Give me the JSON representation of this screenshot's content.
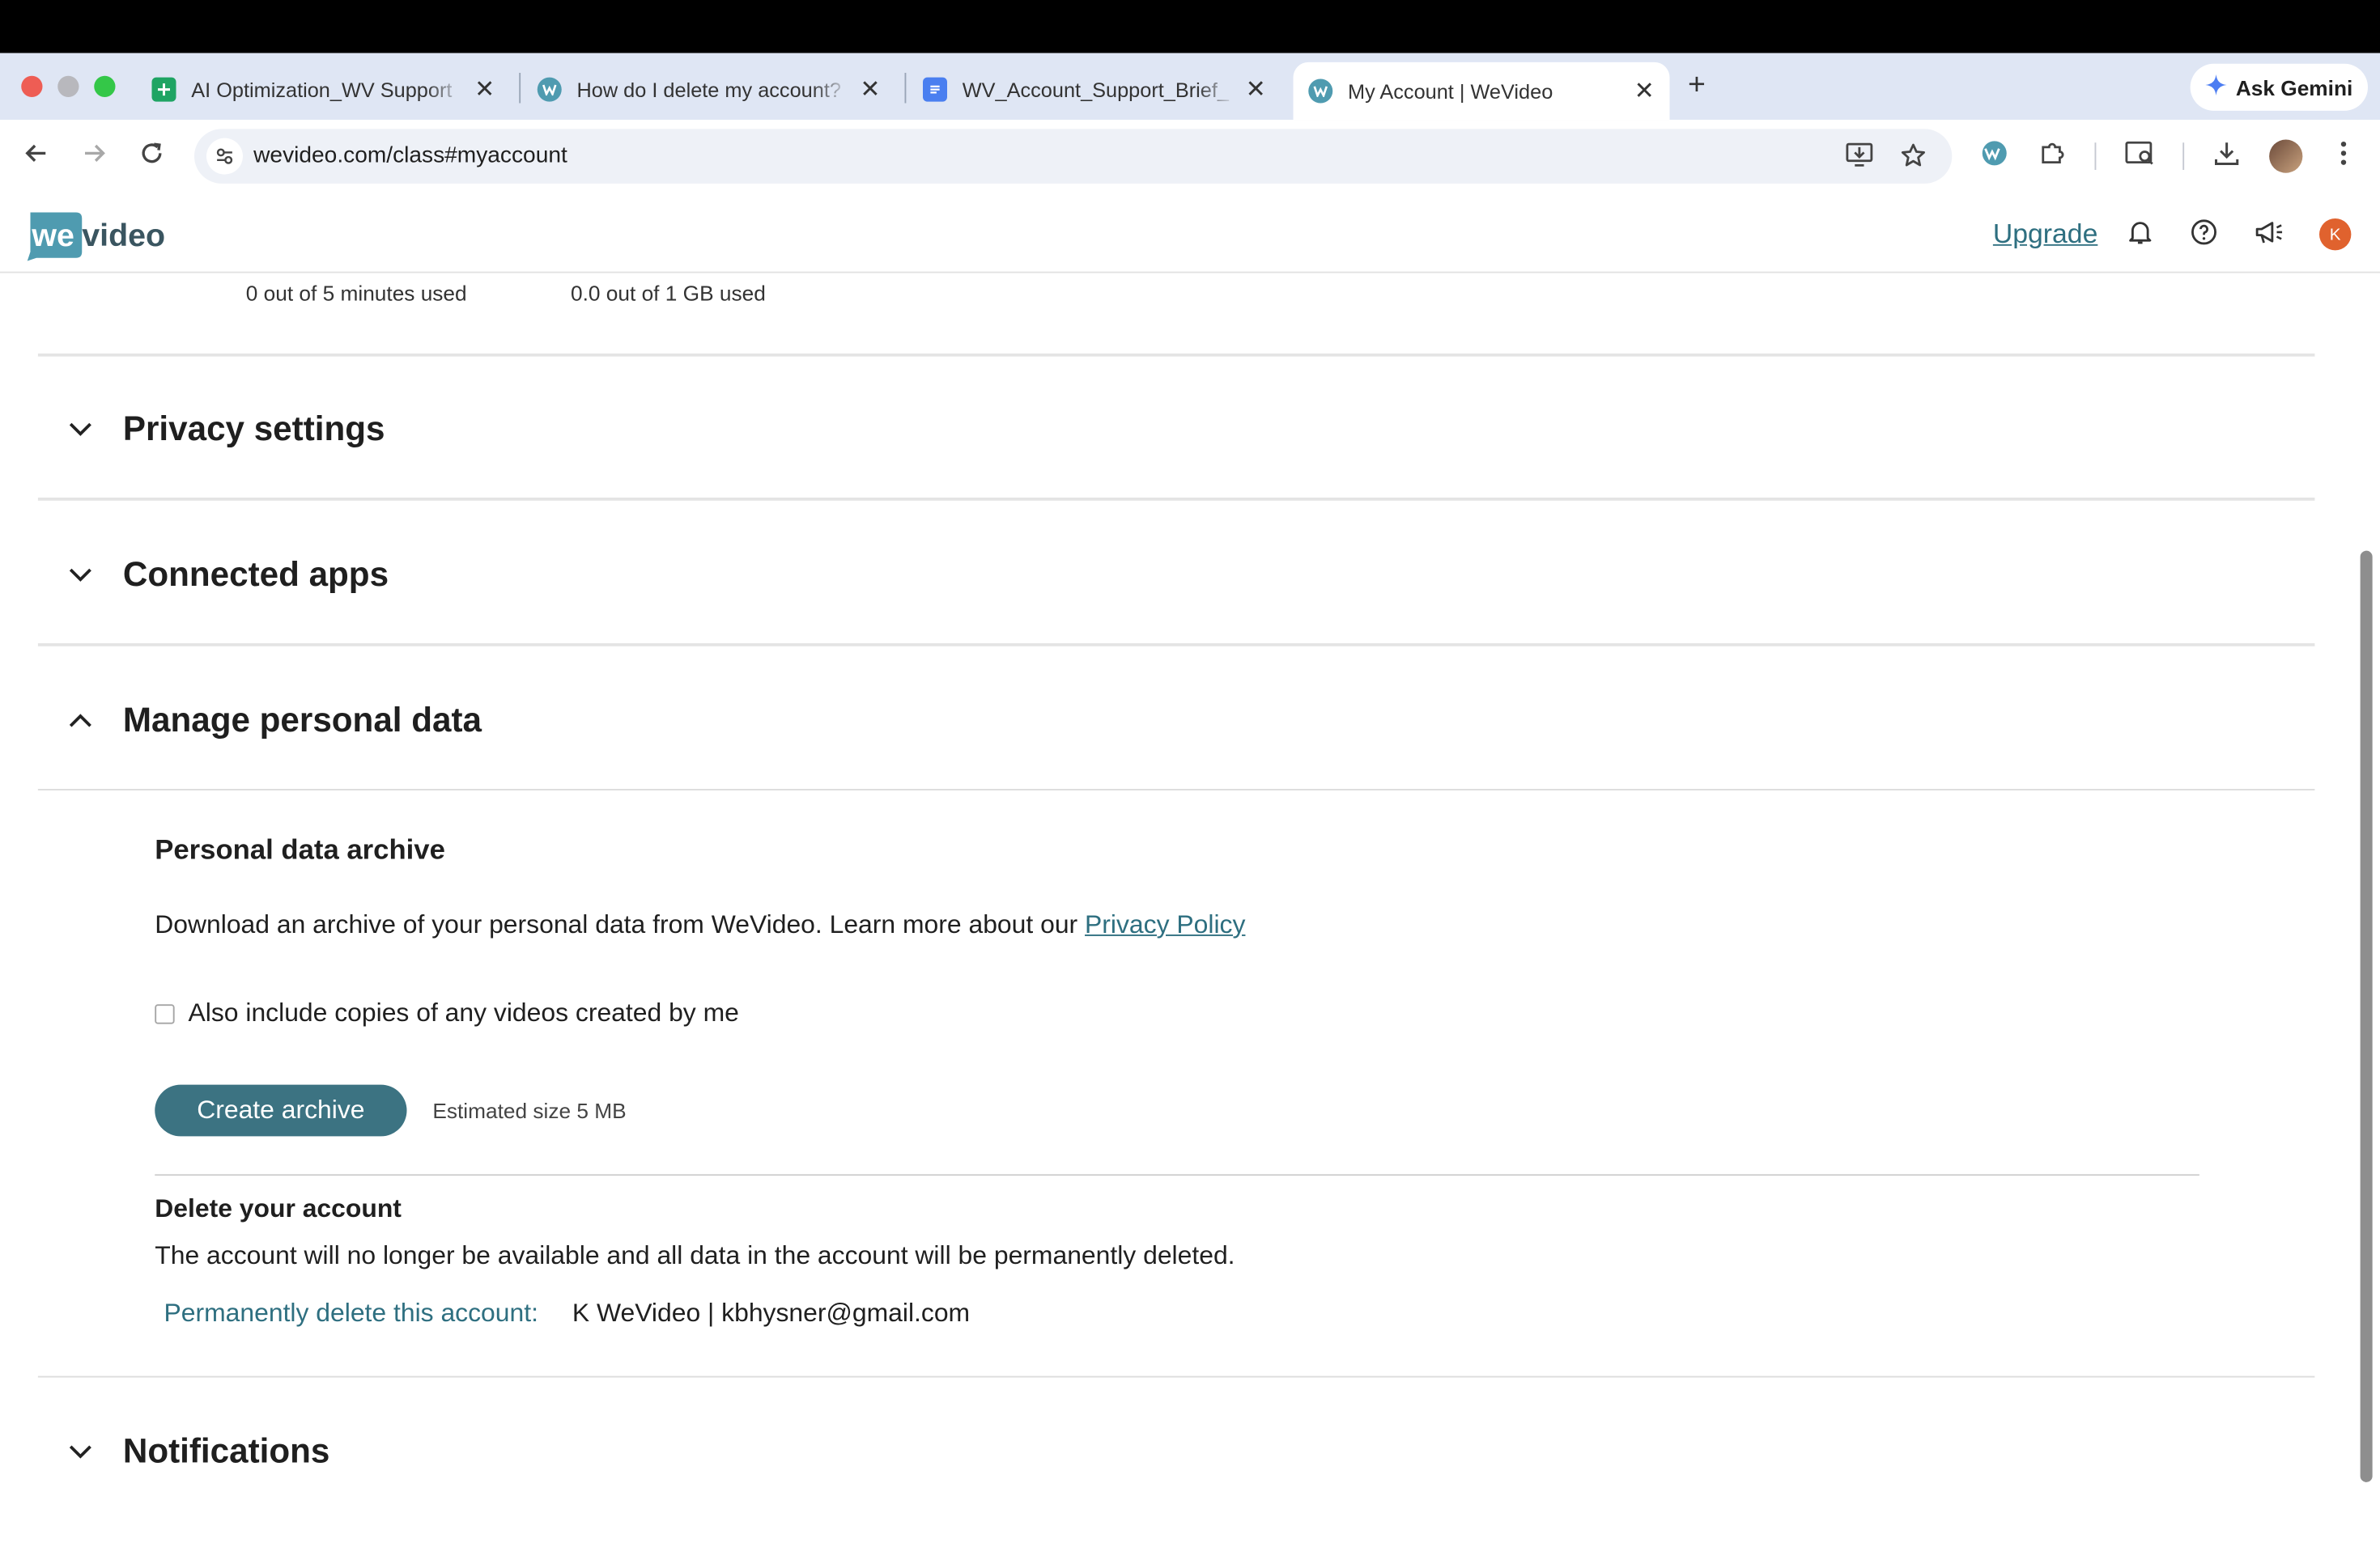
{
  "browser": {
    "tabs": [
      {
        "title": "AI Optimization_WV Support",
        "icon": "sheets-icon",
        "active": false
      },
      {
        "title": "How do I delete my account?",
        "icon": "wevideo-icon",
        "active": false
      },
      {
        "title": "WV_Account_Support_Brief_",
        "icon": "docs-icon",
        "active": false
      },
      {
        "title": "My Account | WeVideo",
        "icon": "wevideo-icon",
        "active": true
      }
    ],
    "new_tab": "+",
    "close_glyph": "✕",
    "gemini_label": "Ask Gemini",
    "url": "wevideo.com/class#myaccount",
    "colors": {
      "tabstrip": "#dfe6f4",
      "omnibox": "#eef1f7"
    }
  },
  "site": {
    "logo_we": "we",
    "logo_video": "video",
    "upgrade_label": "Upgrade",
    "user_initial": "K",
    "accent": "#3c7382"
  },
  "usage": {
    "minutes": "0 out of 5 minutes used",
    "storage": "0.0 out of 1 GB used"
  },
  "sections": {
    "privacy": {
      "title": "Privacy settings",
      "expanded": false
    },
    "connected": {
      "title": "Connected apps",
      "expanded": false
    },
    "manage": {
      "title": "Manage personal data",
      "expanded": true
    },
    "notifications": {
      "title": "Notifications",
      "expanded": false
    }
  },
  "manage_data": {
    "archive_heading": "Personal data archive",
    "archive_text": "Download an archive of your personal data from WeVideo. Learn more about our ",
    "privacy_link": "Privacy Policy",
    "include_videos_label": "Also include copies of any videos created by me",
    "include_videos_checked": false,
    "create_button": "Create archive",
    "estimated_size": "Estimated size 5 MB",
    "delete_heading": "Delete your account",
    "delete_text": "The account will no longer be available and all data in the account will be permanently deleted.",
    "delete_link": "Permanently delete this account:",
    "account_identity": "K WeVideo | kbhysner@gmail.com"
  }
}
